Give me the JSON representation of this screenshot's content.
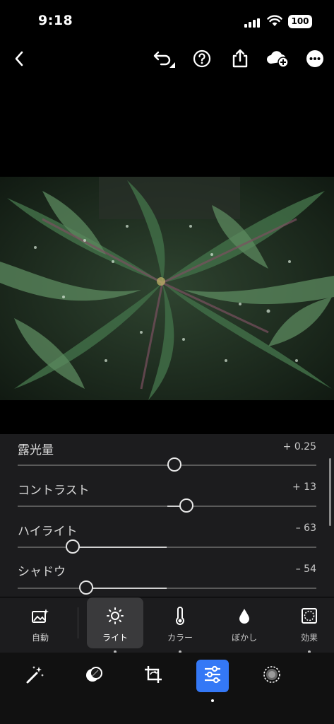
{
  "status": {
    "time": "9:18",
    "battery": "100"
  },
  "toolbar": {
    "back_icon": "chevron-left-icon",
    "undo_icon": "undo-icon",
    "help_icon": "question-circle-icon",
    "share_icon": "share-icon",
    "cloud_icon": "cloud-add-icon",
    "more_icon": "more-icon"
  },
  "photo": {
    "description_icon": "photo"
  },
  "sliders": [
    {
      "label": "露光量",
      "value": "+ 0.25",
      "level": 0.525
    },
    {
      "label": "コントラスト",
      "value": "+ 13",
      "level": 0.565
    },
    {
      "label": "ハイライト",
      "value": "– 63",
      "level": 0.185
    },
    {
      "label": "シャドウ",
      "value": "– 54",
      "level": 0.23
    }
  ],
  "tabs": [
    {
      "label": "自動",
      "icon": "auto-image-icon"
    },
    {
      "label": "ライト",
      "icon": "sun-icon",
      "active": true
    },
    {
      "label": "カラー",
      "icon": "thermometer-icon"
    },
    {
      "label": "ぼかし",
      "icon": "drop-icon"
    },
    {
      "label": "効果",
      "icon": "vignette-icon"
    }
  ],
  "bottom": [
    {
      "icon": "magic-wand-icon"
    },
    {
      "icon": "mask-icon"
    },
    {
      "icon": "crop-icon"
    },
    {
      "icon": "adjust-sliders-icon",
      "active": true
    },
    {
      "icon": "selective-icon"
    }
  ]
}
